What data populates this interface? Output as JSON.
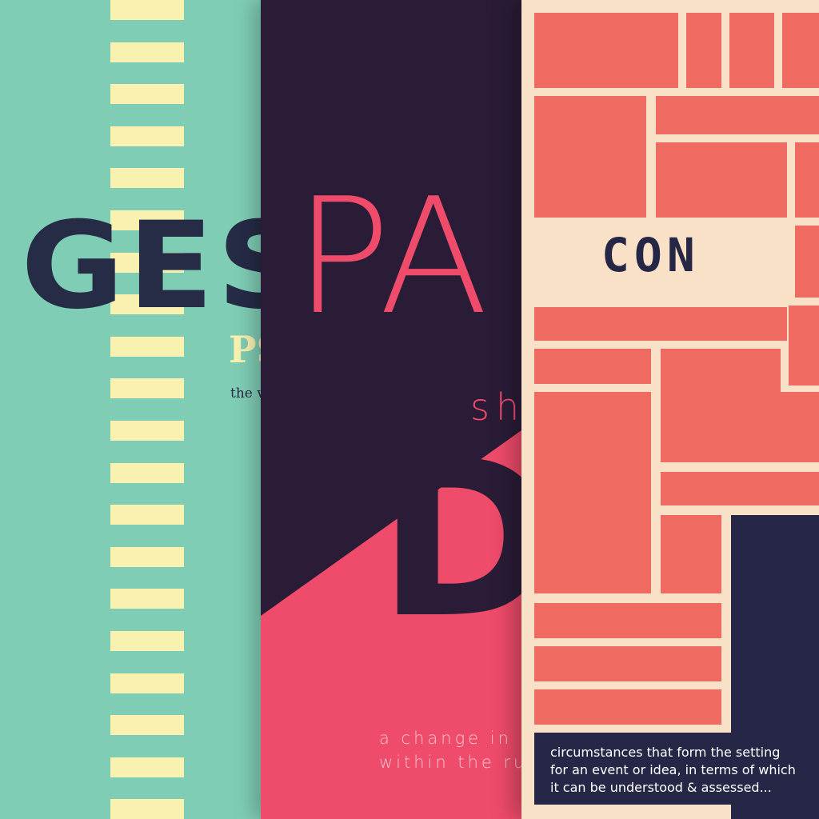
{
  "posters": [
    {
      "title": "GES",
      "subtitle": "PS",
      "description": "the w",
      "colors": {
        "background": "#7fcdb4",
        "stripes": "#f8f1b0",
        "text": "#262b46"
      }
    },
    {
      "title": "PA",
      "subtitle": "sh",
      "big_text": "DI",
      "description_lines": [
        "a change in",
        "within the ru"
      ],
      "colors": {
        "background": "#2a1c37",
        "accent": "#ef4b6a"
      }
    },
    {
      "title": "CON",
      "description_lines": [
        "circumstances that form the setting",
        "for an event or idea, in terms of which",
        "it can be understood & assessed..."
      ],
      "colors": {
        "background": "#f9e1c8",
        "blocks": "#ef6b62",
        "dark": "#262746"
      }
    }
  ]
}
